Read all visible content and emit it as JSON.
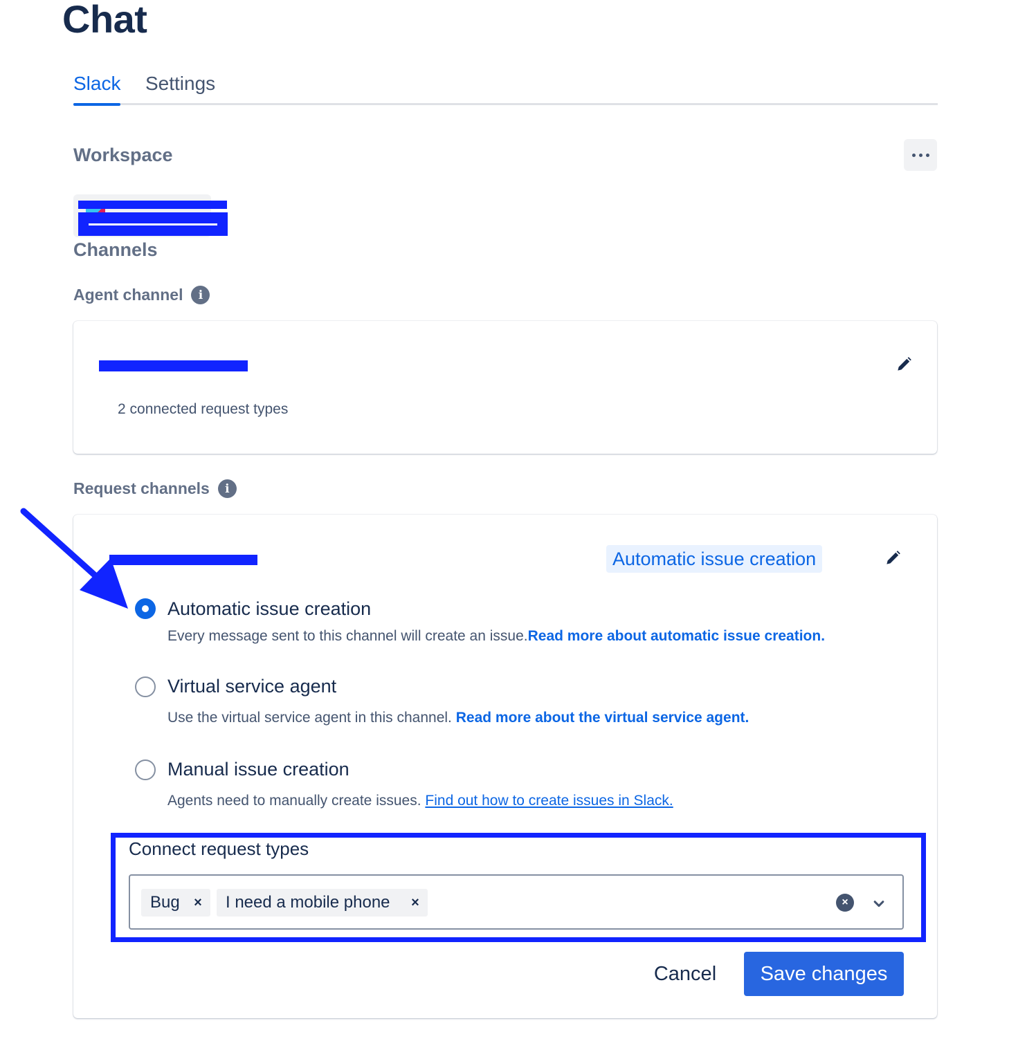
{
  "page": {
    "title": "Chat"
  },
  "tabs": [
    {
      "label": "Slack",
      "active": true
    },
    {
      "label": "Settings",
      "active": false
    }
  ],
  "workspace": {
    "heading": "Workspace"
  },
  "channels": {
    "heading": "Channels",
    "agent": {
      "label": "Agent channel",
      "info_icon": "i",
      "summary": "2 connected request types"
    },
    "request": {
      "label": "Request channels",
      "info_icon": "i",
      "mode_lozenge": "Automatic issue creation",
      "options": [
        {
          "title": "Automatic issue creation",
          "selected": true,
          "desc": "Every message sent to this channel will create an issue.",
          "link": "Read more about automatic issue creation."
        },
        {
          "title": "Virtual service agent",
          "selected": false,
          "desc": "Use the virtual service agent in this channel. ",
          "link": "Read more about the virtual service agent."
        },
        {
          "title": "Manual issue creation",
          "selected": false,
          "desc": "Agents need to manually create issues. ",
          "link": "Find out how to create issues in Slack."
        }
      ],
      "connect": {
        "label": "Connect request types",
        "tags": [
          "Bug",
          "I need a mobile phone"
        ],
        "remove_glyph": "×",
        "clear_glyph": "×"
      },
      "actions": {
        "cancel": "Cancel",
        "save": "Save changes"
      }
    }
  },
  "colors": {
    "accent": "#0c66e4",
    "primary_button": "#2866e0",
    "annotation": "#1124ff"
  },
  "icons": [
    "more-icon",
    "info-icon",
    "pencil-icon",
    "clear-icon",
    "chevron-down-icon",
    "arrow-annotation-icon"
  ]
}
